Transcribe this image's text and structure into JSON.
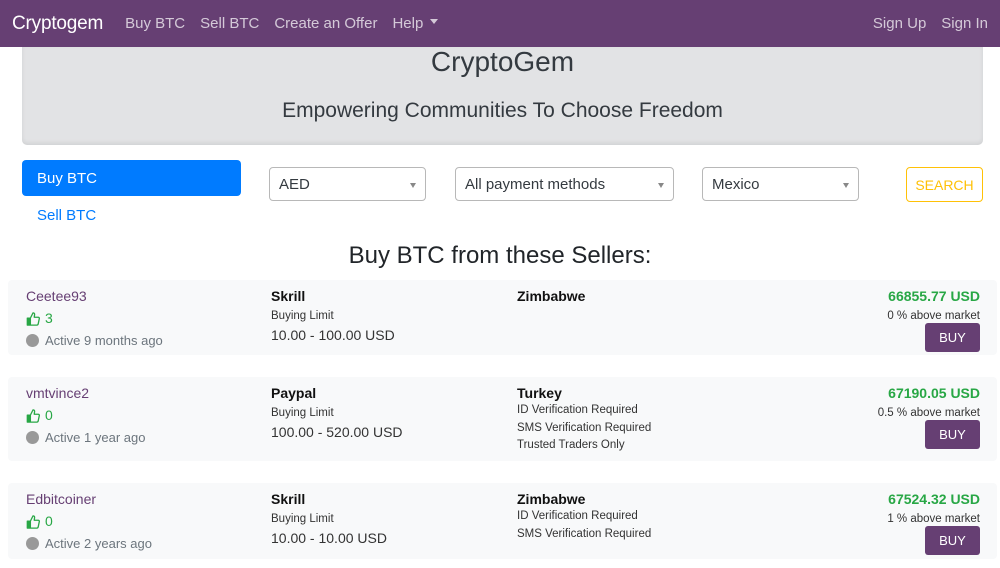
{
  "navbar": {
    "brand": "Cryptogem",
    "links": [
      "Buy BTC",
      "Sell BTC",
      "Create an Offer"
    ],
    "help_label": "Help",
    "sign_up": "Sign Up",
    "sign_in": "Sign In",
    "background_color": "#663f73"
  },
  "hero": {
    "title": "CryptoGem",
    "subtitle": "Empowering Communities To Choose Freedom"
  },
  "filters": {
    "tabs": {
      "buy": "Buy BTC",
      "sell": "Sell BTC",
      "active": "buy"
    },
    "currency": "AED",
    "payment_method": "All payment methods",
    "country": "Mexico",
    "search_label": "SEARCH"
  },
  "section_title": "Buy BTC from these Sellers:",
  "listings": [
    {
      "seller": "Ceetee93",
      "rating": "3",
      "active": "Active 9 months ago",
      "payment_method": "Skrill",
      "limit_label": "Buying Limit",
      "limit_range": "10.00 - 100.00 USD",
      "location": "Zimbabwe",
      "requirements": [],
      "price": "66855.77 USD",
      "market": "0 % above market",
      "buy_label": "BUY"
    },
    {
      "seller": "vmtvince2",
      "rating": "0",
      "active": "Active 1 year ago",
      "payment_method": "Paypal",
      "limit_label": "Buying Limit",
      "limit_range": "100.00 - 520.00 USD",
      "location": "Turkey",
      "requirements": [
        "ID Verification Required",
        "SMS Verification Required",
        "Trusted Traders Only"
      ],
      "price": "67190.05 USD",
      "market": "0.5 % above market",
      "buy_label": "BUY"
    },
    {
      "seller": "Edbitcoiner",
      "rating": "0",
      "active": "Active 2 years ago",
      "payment_method": "Skrill",
      "limit_label": "Buying Limit",
      "limit_range": "10.00 - 10.00 USD",
      "location": "Zimbabwe",
      "requirements": [
        "ID Verification Required",
        "SMS Verification Required"
      ],
      "price": "67524.32 USD",
      "market": "1 % above market",
      "buy_label": "BUY"
    }
  ]
}
